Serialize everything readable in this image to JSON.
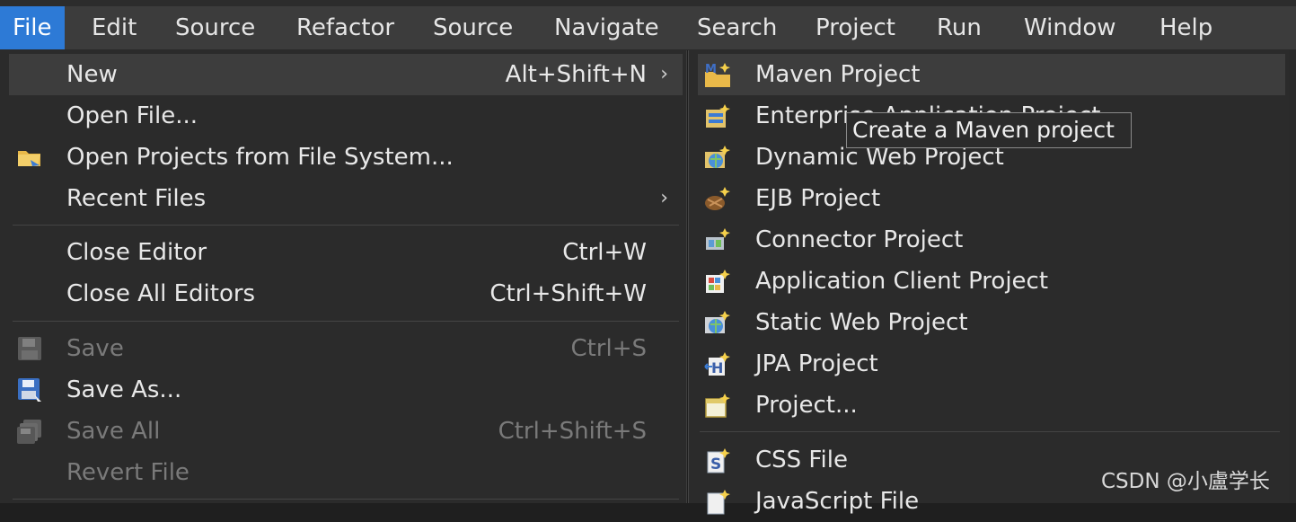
{
  "menubar": {
    "items": [
      "File",
      "Edit",
      "Source",
      "Refactor",
      "Source",
      "Navigate",
      "Search",
      "Project",
      "Run",
      "Window",
      "Help"
    ]
  },
  "file_menu": {
    "new": {
      "label": "New",
      "accel": "Alt+Shift+N",
      "arrow": "›"
    },
    "open_file": {
      "label": "Open File..."
    },
    "open_projects": {
      "label": "Open Projects from File System...",
      "icon": "folder-icon"
    },
    "recent_files": {
      "label": "Recent Files",
      "arrow": "›"
    },
    "close_editor": {
      "label": "Close Editor",
      "accel": "Ctrl+W"
    },
    "close_all_editors": {
      "label": "Close All Editors",
      "accel": "Ctrl+Shift+W"
    },
    "save": {
      "label": "Save",
      "accel": "Ctrl+S",
      "icon": "save-icon"
    },
    "save_as": {
      "label": "Save As...",
      "icon": "save-as-icon"
    },
    "save_all": {
      "label": "Save All",
      "accel": "Ctrl+Shift+S",
      "icon": "save-all-icon"
    },
    "revert_file": {
      "label": "Revert File"
    }
  },
  "new_submenu": {
    "maven_project": "Maven Project",
    "enterprise_application_project": "Enterprise Application Project",
    "dynamic_web_project": "Dynamic Web Project",
    "ejb_project": "EJB Project",
    "connector_project": "Connector Project",
    "application_client_project": "Application Client Project",
    "static_web_project": "Static Web Project",
    "jpa_project": "JPA Project",
    "project": "Project...",
    "css_file": "CSS File",
    "javascript_file": "JavaScript File"
  },
  "tooltip": "Create a Maven project",
  "watermark": "CSDN @小盧学长",
  "colors": {
    "menubar": "#3c3c3c",
    "active_menu": "#2d7ad6",
    "menu_bg": "#2b2b2b",
    "highlight": "#3d3d3d"
  }
}
